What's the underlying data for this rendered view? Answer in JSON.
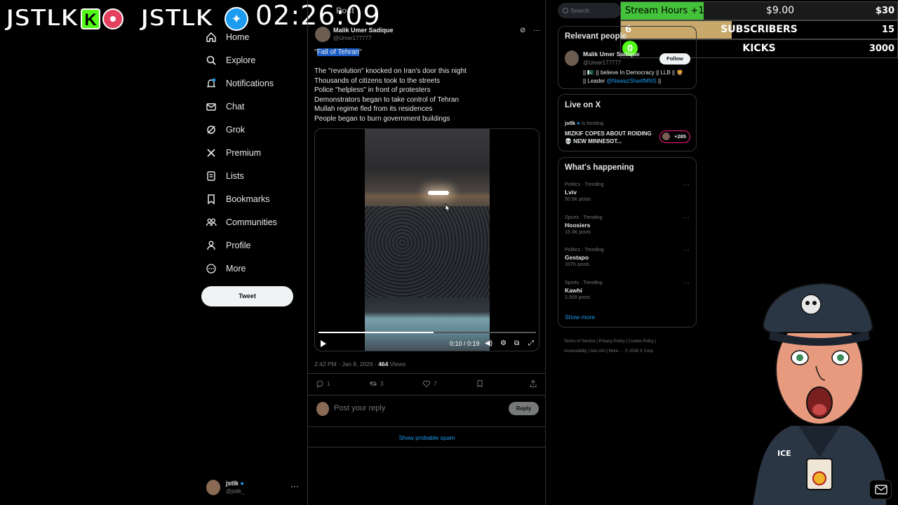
{
  "overlay": {
    "logo_left": "JSTLK",
    "logo_right": "JSTLK",
    "timer": "02:26:09",
    "stats": {
      "hours_label": "Stream Hours +1",
      "hours_amount": "$9.00",
      "hours_goal": "$30",
      "hours_progress": 0.3,
      "subs_current": "6",
      "subs_label": "SUBSCRIBERS",
      "subs_goal": "15",
      "subs_progress": 0.4,
      "kicks_current": "0",
      "kicks_label": "KICKS",
      "kicks_goal": "3000"
    }
  },
  "nav": {
    "items": [
      {
        "label": "Home",
        "icon": "home-icon"
      },
      {
        "label": "Explore",
        "icon": "search-icon"
      },
      {
        "label": "Notifications",
        "icon": "bell-icon"
      },
      {
        "label": "Chat",
        "icon": "mail-icon"
      },
      {
        "label": "Grok",
        "icon": "grok-icon"
      },
      {
        "label": "Premium",
        "icon": "x-logo-icon"
      },
      {
        "label": "Lists",
        "icon": "list-icon"
      },
      {
        "label": "Bookmarks",
        "icon": "bookmark-icon"
      },
      {
        "label": "Communities",
        "icon": "people-icon"
      },
      {
        "label": "Profile",
        "icon": "person-icon"
      },
      {
        "label": "More",
        "icon": "more-circle-icon"
      }
    ],
    "tweet_button": "Tweet",
    "account_name": "jstlk",
    "account_handle": "@jstlk_"
  },
  "post": {
    "header_label": "Post",
    "author_name": "Malik Umer Sadique",
    "author_handle": "@Umer177777",
    "quote_open": "\"",
    "highlight": "Fall of Tehran",
    "quote_close": "\"",
    "lines": [
      "The \"revolution\" knocked on Iran's door this night",
      "Thousands of citizens took to the streets",
      "Police \"helpless\" in front of protesters",
      "Demonstrators began to take control of Tehran",
      "Mullah regime fled from its residences",
      "People began to burn government buildings"
    ],
    "video_time": "0:10 / 0:19",
    "video_progress": 0.53,
    "meta_time": "2:42 PM · Jan 8, 2026 · ",
    "views_count": "464",
    "views_label": " Views",
    "replies": "1",
    "reposts": "3",
    "likes": "7",
    "reply_placeholder": "Post your reply",
    "reply_button": "Reply",
    "show_spam": "Show probable spam"
  },
  "sidebar": {
    "search_placeholder": "Search",
    "relevant_title": "Relevant people",
    "relevant_name": "Malik Umer Sadique",
    "relevant_handle": "@Umer177777",
    "follow": "Follow",
    "bio_line1": "|| 🇵🇰 || believe In Democracy || LLB || 🦁",
    "bio_prefix": "|| Leader ",
    "bio_link": "@NawazSharifMNS",
    "bio_suffix": " ||",
    "live_title": "Live on X",
    "live_host": "jstlk",
    "live_host_suffix": " is hosting",
    "live_stream_title": "MIZKIF COPES ABOUT ROIDING 💀 NEW MINNESOT...",
    "live_count": "+285",
    "happening_title": "What's happening",
    "trends": [
      {
        "category": "Politics · Trending",
        "name": "Lviv",
        "count": "50.5K posts"
      },
      {
        "category": "Sports · Trending",
        "name": "Hoosiers",
        "count": "15.3K posts"
      },
      {
        "category": "Politics · Trending",
        "name": "Gestapo",
        "count": "107K posts"
      },
      {
        "category": "Sports · Trending",
        "name": "Kawhi",
        "count": "2,909 posts"
      }
    ],
    "show_more": "Show more",
    "footer_line1": "Terms of Service  |  Privacy Policy  |  Cookie Policy  |",
    "footer_line2": "Accessibility  |  Ads info  |  More ···  © 2026 X Corp."
  },
  "colors": {
    "accent": "#1d9bf0",
    "kick_green": "#53fc18",
    "subs_gold": "#c8a96b",
    "live_pink": "#f91880"
  }
}
